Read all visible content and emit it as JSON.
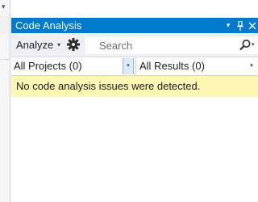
{
  "panel": {
    "title": "Code Analysis",
    "accent_color": "#007acc",
    "title_buttons": [
      {
        "icon": "dropdown-arrow-icon",
        "glyph": "▾"
      },
      {
        "icon": "pin-icon",
        "glyph": "⊥"
      },
      {
        "icon": "close-icon",
        "glyph": "✕"
      }
    ]
  },
  "toolbar": {
    "analyze_label": "Analyze",
    "analyze_caret": "▾",
    "settings_icon": "gear-icon",
    "search": {
      "placeholder": "Search",
      "icon": "search-icon",
      "caret": "▾"
    }
  },
  "filters": {
    "projects": {
      "value": "All Projects (0)",
      "caret": "▾"
    },
    "results": {
      "value": "All Results (0)",
      "caret": "▾"
    }
  },
  "message": {
    "text": "No code analysis issues were detected.",
    "background": "#fdf7b3"
  },
  "left_pane": {
    "caret": "▾"
  }
}
